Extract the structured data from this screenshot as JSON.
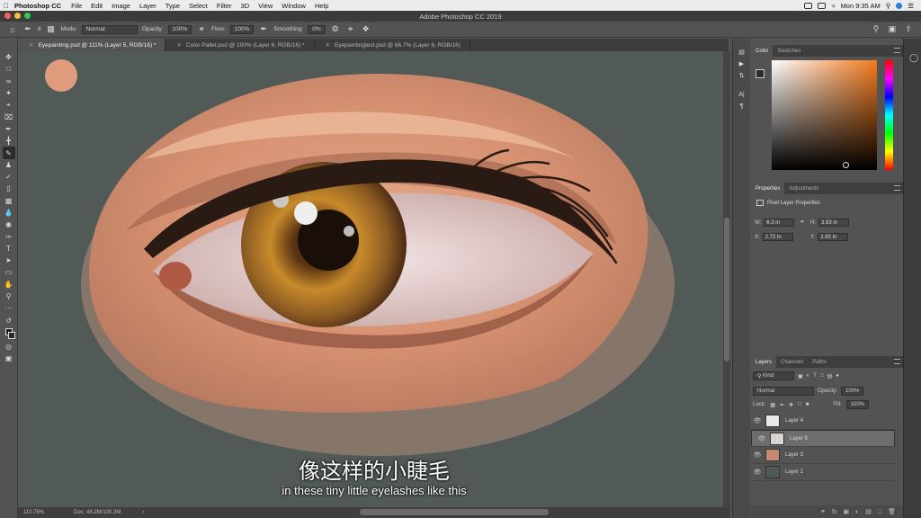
{
  "menubar": {
    "app_name": "Photoshop CC",
    "items": [
      "File",
      "Edit",
      "Image",
      "Layer",
      "Type",
      "Select",
      "Filter",
      "3D",
      "View",
      "Window",
      "Help"
    ],
    "clock": "Mon 9:35 AM"
  },
  "window": {
    "title": "Adobe Photoshop CC 2019"
  },
  "options": {
    "brush_size": "8",
    "mode_label": "Mode:",
    "mode_value": "Normal",
    "opacity_label": "Opacity:",
    "opacity_value": "100%",
    "flow_label": "Flow:",
    "flow_value": "100%",
    "smoothing_label": "Smoothing:",
    "smoothing_value": "0%"
  },
  "tabs": [
    {
      "label": "Eyepainting.psd @ 111% (Layer 5, RGB/16) *",
      "active": true
    },
    {
      "label": "Color Pallet.psd @ 100% (Layer 6, RGB/16) *",
      "active": false
    },
    {
      "label": "Eyepaintingtest.psd @ 66.7% (Layer 6, RGB/16)",
      "active": false
    }
  ],
  "status": {
    "zoom": "110.76%",
    "doc": "Doc: 48.2M/100.3M"
  },
  "color_panel": {
    "tabs": [
      "Color",
      "Swatches"
    ],
    "base_hue": "#f37a1c"
  },
  "properties_panel": {
    "tabs": [
      "Properties",
      "Adjustments"
    ],
    "subtitle": "Pixel Layer Properties",
    "w_label": "W:",
    "w_value": "6.3 in",
    "h_label": "H:",
    "h_value": "3.93 in",
    "x_label": "X:",
    "x_value": "2.72 in",
    "y_label": "Y:",
    "y_value": "1.92 in"
  },
  "layers_panel": {
    "tabs": [
      "Layers",
      "Channels",
      "Paths"
    ],
    "kind_label": "Kind",
    "blend_mode": "Normal",
    "opacity_label": "Opacity:",
    "opacity_value": "100%",
    "lock_label": "Lock:",
    "fill_label": "Fill:",
    "fill_value": "100%",
    "layers": [
      {
        "name": "Layer 4",
        "selected": false
      },
      {
        "name": "Layer 5",
        "selected": true
      },
      {
        "name": "Layer 3",
        "selected": false
      },
      {
        "name": "Layer 1",
        "selected": false
      }
    ]
  },
  "subtitles": {
    "chinese": "像这样的小睫毛",
    "english": "in these tiny little eyelashes like this"
  }
}
